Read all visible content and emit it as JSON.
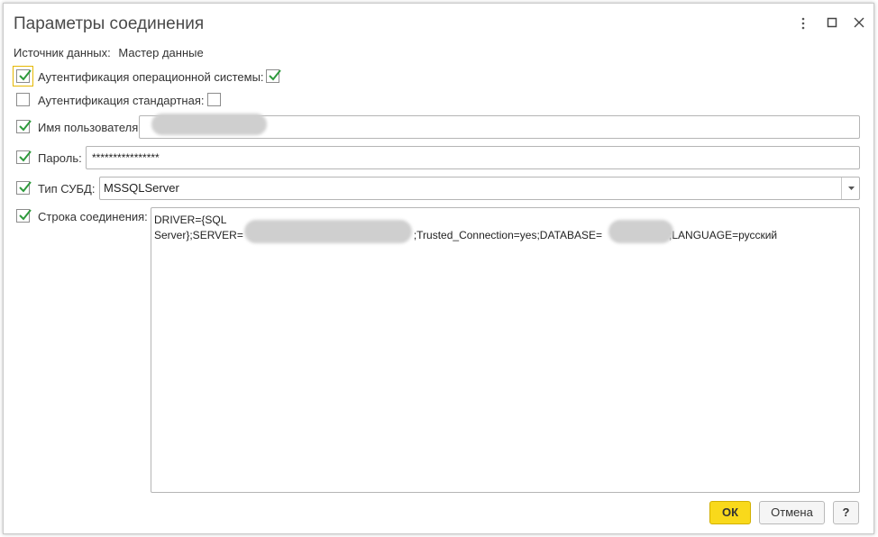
{
  "window": {
    "title": "Параметры соединения",
    "more_icon": "vertical-dots-icon",
    "maximize_icon": "maximize-icon",
    "close_icon": "close-icon"
  },
  "data_source": {
    "label": "Источник данных:",
    "value": "Мастер данные"
  },
  "fields": {
    "os_auth": {
      "label": "Аутентификация операционной системы:",
      "checked": true,
      "value_checked": true
    },
    "std_auth": {
      "label": "Аутентификация стандартная:",
      "checked": false,
      "value_checked": false
    },
    "username": {
      "label": "Имя пользователя:",
      "checked": true,
      "value": ""
    },
    "password": {
      "label": "Пароль:",
      "checked": true,
      "value": "****************"
    },
    "dbms_type": {
      "label": "Тип СУБД:",
      "checked": true,
      "value": "MSSQLServer"
    },
    "conn_string": {
      "label": "Строка соединения:",
      "checked": true,
      "line1": "DRIVER={SQL",
      "line2_a": "Server};SERVER=",
      "line2_b": ";Trusted_Connection=yes;DATABASE=",
      "line2_c": ";LANGUAGE=русский"
    }
  },
  "buttons": {
    "ok": "ОК",
    "cancel": "Отмена",
    "help": "?"
  },
  "colors": {
    "check_green": "#2e9a3c",
    "ok_yellow": "#f9d91b",
    "focus_outline": "#e6b800"
  }
}
